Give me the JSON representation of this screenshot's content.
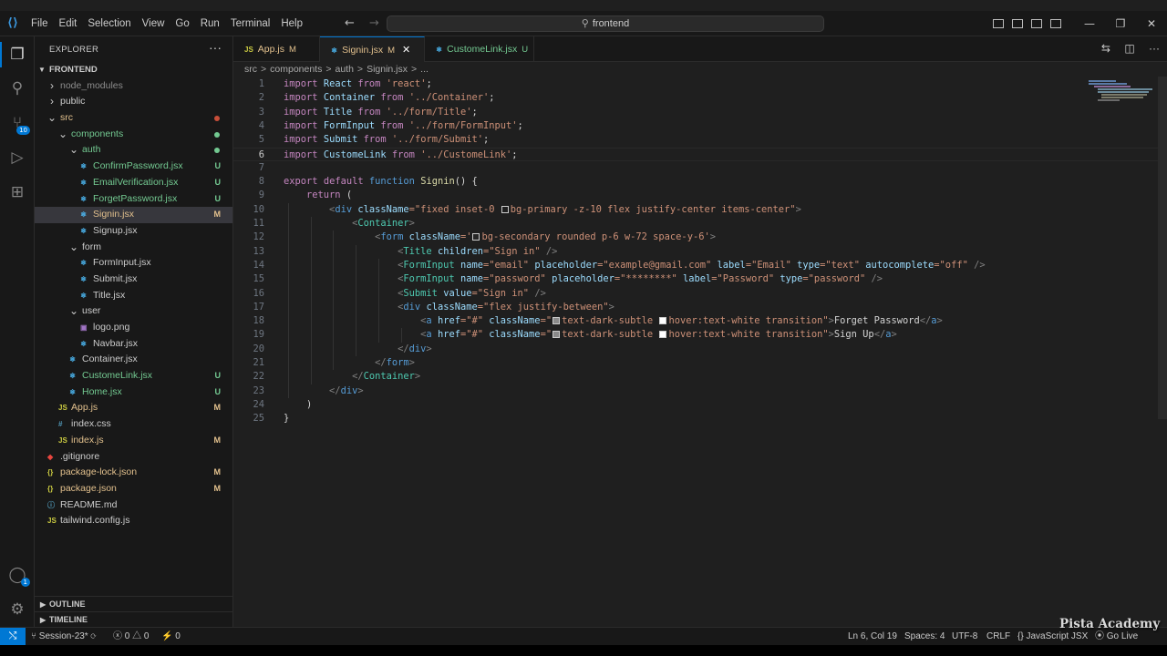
{
  "titlebar": {
    "menus": [
      "File",
      "Edit",
      "Selection",
      "View",
      "Go",
      "Run",
      "Terminal",
      "Help"
    ],
    "search": "frontend"
  },
  "sidebar": {
    "header": "EXPLORER",
    "root": "FRONTEND",
    "outline": "OUTLINE",
    "timeline": "TIMELINE",
    "tree": [
      {
        "name": "node_modules",
        "indent": 1,
        "type": "folder",
        "open": false,
        "color": "#8c8c8c",
        "status": "",
        "dot": ""
      },
      {
        "name": "public",
        "indent": 1,
        "type": "folder",
        "open": false,
        "color": "#cccccc",
        "status": "",
        "dot": ""
      },
      {
        "name": "src",
        "indent": 1,
        "type": "folder",
        "open": true,
        "color": "#e2c08d",
        "status": "",
        "dot": "#c74e39"
      },
      {
        "name": "components",
        "indent": 2,
        "type": "folder",
        "open": true,
        "color": "#73c991",
        "status": "",
        "dot": "#73c991"
      },
      {
        "name": "auth",
        "indent": 3,
        "type": "folder",
        "open": true,
        "color": "#73c991",
        "status": "",
        "dot": "#73c991"
      },
      {
        "name": "ConfirmPassword.jsx",
        "indent": 4,
        "type": "react",
        "color": "#73c991",
        "status": "U",
        "dot": ""
      },
      {
        "name": "EmailVerification.jsx",
        "indent": 4,
        "type": "react",
        "color": "#73c991",
        "status": "U",
        "dot": ""
      },
      {
        "name": "ForgetPassword.jsx",
        "indent": 4,
        "type": "react",
        "color": "#73c991",
        "status": "U",
        "dot": ""
      },
      {
        "name": "Signin.jsx",
        "indent": 4,
        "type": "react",
        "color": "#e2c08d",
        "status": "M",
        "dot": "",
        "selected": true
      },
      {
        "name": "Signup.jsx",
        "indent": 4,
        "type": "react",
        "color": "#cccccc",
        "status": "",
        "dot": ""
      },
      {
        "name": "form",
        "indent": 3,
        "type": "folder",
        "open": true,
        "color": "#cccccc",
        "status": "",
        "dot": ""
      },
      {
        "name": "FormInput.jsx",
        "indent": 4,
        "type": "react",
        "color": "#cccccc",
        "status": "",
        "dot": ""
      },
      {
        "name": "Submit.jsx",
        "indent": 4,
        "type": "react",
        "color": "#cccccc",
        "status": "",
        "dot": ""
      },
      {
        "name": "Title.jsx",
        "indent": 4,
        "type": "react",
        "color": "#cccccc",
        "status": "",
        "dot": ""
      },
      {
        "name": "user",
        "indent": 3,
        "type": "folder",
        "open": true,
        "color": "#cccccc",
        "status": "",
        "dot": ""
      },
      {
        "name": "logo.png",
        "indent": 4,
        "type": "image",
        "color": "#cccccc",
        "status": "",
        "dot": ""
      },
      {
        "name": "Navbar.jsx",
        "indent": 4,
        "type": "react",
        "color": "#cccccc",
        "status": "",
        "dot": ""
      },
      {
        "name": "Container.jsx",
        "indent": 3,
        "type": "react",
        "color": "#cccccc",
        "status": "",
        "dot": ""
      },
      {
        "name": "CustomeLink.jsx",
        "indent": 3,
        "type": "react",
        "color": "#73c991",
        "status": "U",
        "dot": ""
      },
      {
        "name": "Home.jsx",
        "indent": 3,
        "type": "react",
        "color": "#73c991",
        "status": "U",
        "dot": ""
      },
      {
        "name": "App.js",
        "indent": 2,
        "type": "js",
        "color": "#e2c08d",
        "status": "M",
        "dot": ""
      },
      {
        "name": "index.css",
        "indent": 2,
        "type": "css",
        "color": "#cccccc",
        "status": "",
        "dot": ""
      },
      {
        "name": "index.js",
        "indent": 2,
        "type": "js",
        "color": "#e2c08d",
        "status": "M",
        "dot": ""
      },
      {
        "name": ".gitignore",
        "indent": 1,
        "type": "git",
        "color": "#cccccc",
        "status": "",
        "dot": ""
      },
      {
        "name": "package-lock.json",
        "indent": 1,
        "type": "json",
        "color": "#e2c08d",
        "status": "M",
        "dot": ""
      },
      {
        "name": "package.json",
        "indent": 1,
        "type": "json",
        "color": "#e2c08d",
        "status": "M",
        "dot": ""
      },
      {
        "name": "README.md",
        "indent": 1,
        "type": "md",
        "color": "#cccccc",
        "status": "",
        "dot": ""
      },
      {
        "name": "tailwind.config.js",
        "indent": 1,
        "type": "js",
        "color": "#cccccc",
        "status": "",
        "dot": ""
      }
    ]
  },
  "tabs": [
    {
      "name": "App.js",
      "icon": "JS",
      "status": "M",
      "active": false,
      "color": "#e2c08d"
    },
    {
      "name": "Signin.jsx",
      "icon": "⚛",
      "status": "M",
      "active": true,
      "color": "#e2c08d"
    },
    {
      "name": "CustomeLink.jsx",
      "icon": "⚛",
      "status": "U",
      "active": false,
      "color": "#73c991"
    }
  ],
  "breadcrumbs": [
    "src",
    ">",
    "components",
    ">",
    "auth",
    ">",
    "Signin.jsx",
    ">",
    "..."
  ],
  "code_lines": [
    "1",
    "2",
    "3",
    "4",
    "5",
    "6",
    "7",
    "8",
    "9",
    "10",
    "11",
    "12",
    "13",
    "14",
    "15",
    "16",
    "17",
    "18",
    "19",
    "20",
    "21",
    "22",
    "23",
    "24",
    "25"
  ],
  "code": {
    "l1": [
      "import",
      "React",
      "from",
      "'react'",
      ";"
    ],
    "l2": [
      "import",
      "Container",
      "from",
      "'../Container'",
      ";"
    ],
    "l3": [
      "import",
      "Title",
      "from",
      "'../form/Title'",
      ";"
    ],
    "l4": [
      "import",
      "FormInput",
      "from",
      "'../form/FormInput'",
      ";"
    ],
    "l5": [
      "import",
      "Submit",
      "from",
      "'../form/Submit'",
      ";"
    ],
    "l6": [
      "import",
      "CustomeLink",
      "from",
      "'../CustomeLink'",
      ";"
    ],
    "l8": [
      "export",
      "default",
      "function",
      "Signin",
      "() {"
    ],
    "l9": [
      "return",
      "("
    ],
    "l10": [
      "<",
      "div",
      "className",
      "=\"fixed inset-0 ",
      "bg-primary -z-10 flex justify-center items-center\"",
      ">"
    ],
    "l11": [
      "<",
      "Container",
      ">"
    ],
    "l12": [
      "<",
      "form",
      "className",
      "='",
      "bg-secondary rounded p-6 w-72 space-y-6'",
      ">"
    ],
    "l13": [
      "<",
      "Title",
      "children",
      "=\"Sign in\"",
      "/>"
    ],
    "l14": [
      "<",
      "FormInput",
      "name",
      "=\"email\"",
      "placeholder",
      "=\"example@gmail.com\"",
      "label",
      "=\"Email\"",
      "type",
      "=\"text\"",
      "autocomplete",
      "=\"off\"",
      "/>"
    ],
    "l15": [
      "<",
      "FormInput",
      "name",
      "=\"password\"",
      "placeholder",
      "=\"********\"",
      "label",
      "=\"Password\"",
      "type",
      "=\"password\"",
      "/>"
    ],
    "l16": [
      "<",
      "Submit",
      "value",
      "=\"Sign in\"",
      "/>"
    ],
    "l17": [
      "<",
      "div",
      "className",
      "=\"flex justify-between\"",
      ">"
    ],
    "l18": [
      "<",
      "a",
      "href",
      "=\"#\"",
      "className",
      "=\"",
      "text-dark-subtle ",
      "hover:text-white transition\"",
      ">",
      "Forget Password",
      "</",
      "a",
      ">"
    ],
    "l19": [
      "<",
      "a",
      "href",
      "=\"#\"",
      "className",
      "=\"",
      "text-dark-subtle ",
      "hover:text-white transition\"",
      ">",
      "Sign Up",
      "</",
      "a",
      ">"
    ],
    "l20": [
      "</",
      "div",
      ">"
    ],
    "l21": [
      "</",
      "form",
      ">"
    ],
    "l22": [
      "</",
      "Container",
      ">"
    ],
    "l23": [
      "</",
      "div",
      ">"
    ],
    "l24": [
      ")"
    ],
    "l25": [
      "}"
    ]
  },
  "status": {
    "branch": "Session-23*",
    "errors": "0",
    "warnings": "0",
    "ports": "0",
    "position": "Ln 6, Col 19",
    "spaces": "Spaces: 4",
    "encoding": "UTF-8",
    "eol": "CRLF",
    "language": "JavaScript JSX",
    "golive": "Go Live"
  },
  "watermark": "Pista Academy",
  "colors": {
    "accent": "#0078d4",
    "modified": "#e2c08d",
    "untracked": "#73c991"
  }
}
